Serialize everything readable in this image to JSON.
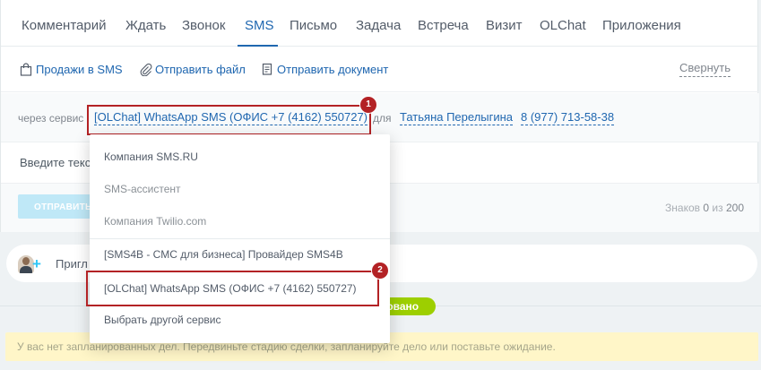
{
  "tabs": [
    "Комментарий",
    "Ждать",
    "Звонок",
    "SMS",
    "Письмо",
    "Задача",
    "Встреча",
    "Визит",
    "OLChat",
    "Приложения"
  ],
  "active_tab": "SMS",
  "toolbar": {
    "sales_sms": "Продажи в SMS",
    "send_file": "Отправить файл",
    "send_document": "Отправить документ",
    "collapse": "Свернуть"
  },
  "service_row": {
    "prefix": "через сервис",
    "service": "[OLChat] WhatsApp SMS (ОФИС +7 (4162) 550727)",
    "for_label": "для",
    "recipient": "Татьяна Перелыгина",
    "phone": "8 (977) 713-58-38"
  },
  "message": {
    "placeholder": "Введите текс"
  },
  "send": {
    "button": "ОТПРАВИТЬ",
    "counter_prefix": "Знаков",
    "count": "0",
    "counter_of": "из",
    "max": "200"
  },
  "invite": {
    "text": "Пригл"
  },
  "status_pill": "ровано",
  "notice": "У вас нет запланированных дел. Передвиньте стадию сделки, запланируйте дело или поставьте ожидание.",
  "dropdown": {
    "items": [
      {
        "label": "Компания SMS.RU"
      },
      {
        "label": "SMS-ассистент"
      },
      {
        "label": "Компания Twilio.com"
      },
      {
        "label": "[SMS4B - СМС для бизнеса] Провайдер SMS4B"
      },
      {
        "label": "[OLChat] WhatsApp SMS (ОФИС +7 (4162) 550727)"
      },
      {
        "label": "Выбрать другой сервис"
      }
    ]
  },
  "badges": [
    "1",
    "2"
  ],
  "colors": {
    "accent": "#2067b0",
    "annotation": "#b32225",
    "status_green": "#9dcf00",
    "notice_bg": "#fff6c8",
    "send_button": "#bfe8f7"
  }
}
